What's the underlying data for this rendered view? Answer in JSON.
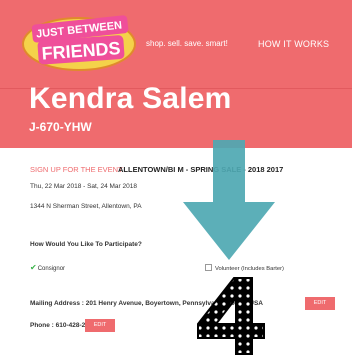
{
  "header": {
    "logo_line1": "JUST BETWEEN",
    "logo_line2": "FRIENDS",
    "tagline": "shop. sell. save. smart!",
    "nav_how_it_works": "HOW IT WORKS"
  },
  "profile": {
    "name": "Kendra Salem",
    "code": "J-670-YHW"
  },
  "event": {
    "signup_label": "SIGN UP FOR THE EVENT",
    "title": "ALLENTOWN/BI    M - SPRING SALE - 2018 2017",
    "dates": "Thu, 22 Mar 2018 - Sat, 24 Mar 2018",
    "address": "1344 N Sherman Street, Allentown, PA"
  },
  "participation": {
    "question": "How Would You Like To Participate?",
    "consignor": "Consignor",
    "volunteer": "Volunteer (Includes Barter)"
  },
  "contact": {
    "mailing": "Mailing Address : 201 Henry Avenue, Boyertown, Pennsylvania, 19512, USA",
    "phone": "Phone : 610-428-2884",
    "edit_label": "EDIT"
  },
  "overlay": {
    "number": "4"
  },
  "colors": {
    "brand": "#ef6b6e",
    "arrow": "#4ea8b2",
    "check": "#3ab34a"
  }
}
